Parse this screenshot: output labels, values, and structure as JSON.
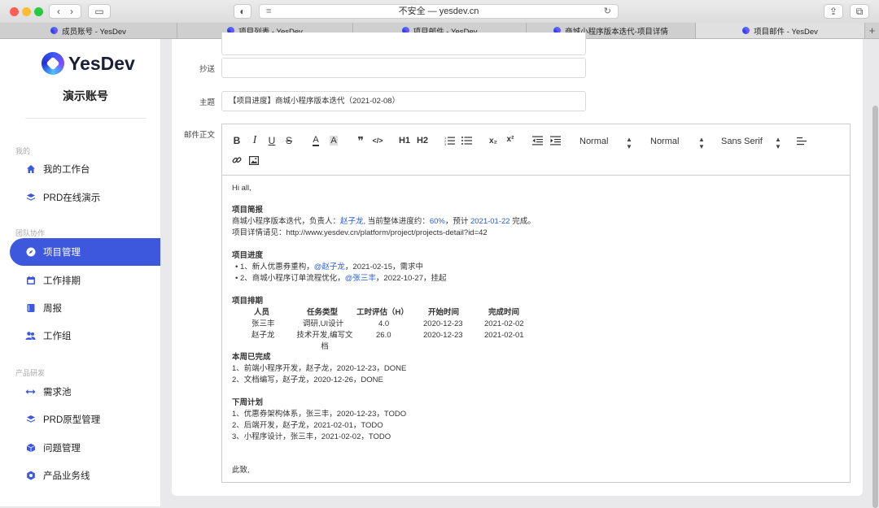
{
  "browser": {
    "address": "不安全 — yesdev.cn",
    "tabs": [
      {
        "label": "成员账号 - YesDev",
        "active": false
      },
      {
        "label": "项目列表 - YesDev",
        "active": false
      },
      {
        "label": "项目邮件 - YesDev",
        "active": false
      },
      {
        "label": "商城小程序版本迭代-项目详情",
        "active": false
      },
      {
        "label": "项目邮件 - YesDev",
        "active": true
      }
    ],
    "new_tab": "+"
  },
  "sidebar": {
    "logo_text": "YesDev",
    "account": "演示账号",
    "groups": [
      "我的",
      "团队协作",
      "产品研发"
    ],
    "items": [
      {
        "label": "我的工作台",
        "icon": "home-icon"
      },
      {
        "label": "PRD在线演示",
        "icon": "layers-icon"
      },
      {
        "label": "项目管理",
        "icon": "compass-icon",
        "active": true
      },
      {
        "label": "工作排期",
        "icon": "calendar-icon"
      },
      {
        "label": "周报",
        "icon": "book-icon"
      },
      {
        "label": "工作组",
        "icon": "group-icon"
      },
      {
        "label": "需求池",
        "icon": "arrows-icon"
      },
      {
        "label": "PRD原型管理",
        "icon": "layers-icon"
      },
      {
        "label": "问题管理",
        "icon": "cube-icon"
      },
      {
        "label": "产品业务线",
        "icon": "gear-icon"
      }
    ]
  },
  "form": {
    "cc_label": "抄送",
    "cc_value": "",
    "subject_label": "主题",
    "subject_value": "【项目进度】商城小程序版本迭代（2021-02-08）",
    "body_label": "邮件正文"
  },
  "toolbar": {
    "bold": "B",
    "italic": "I",
    "underline": "U",
    "strike": "S",
    "quote": "❞",
    "code": "</>",
    "h1": "H1",
    "h2": "H2",
    "sub": "x₂",
    "sup": "x²",
    "select1": "Normal",
    "select2": "Normal",
    "select3": "Sans Serif"
  },
  "email": {
    "greeting": "Hi all,",
    "brief_title": "项目简报",
    "brief_l1_a": "商城小程序版本迭代，负责人：",
    "brief_owner": "赵子龙",
    "brief_l1_b": ", 当前整体进度约：",
    "brief_progress": "60%",
    "brief_l1_c": "，预计 ",
    "brief_date": "2021-01-22",
    "brief_l1_d": " 完成。",
    "brief_l2": "项目详情请见：http://www.yesdev.cn/platform/project/projects-detail?id=42",
    "progress_title": "项目进度",
    "progress_1a": "• 1、新人优惠券重构，",
    "progress_1_user": "@赵子龙",
    "progress_1b": "，2021-02-15，需求中",
    "progress_2a": "• 2、商城小程序订单流程优化，",
    "progress_2_user": "@张三丰",
    "progress_2b": "，2022-10-27，挂起",
    "schedule_title": "项目排期",
    "schedule_headers": [
      "人员",
      "任务类型",
      "工时评估（H）",
      "开始时间",
      "完成时间"
    ],
    "schedule_rows": [
      [
        "张三丰",
        "调研,UI设计",
        "4.0",
        "2020-12-23",
        "2021-02-02"
      ],
      [
        "赵子龙",
        "技术开发,编写文档",
        "26.0",
        "2020-12-23",
        "2021-02-01"
      ]
    ],
    "done_title": "本周已完成",
    "done": [
      "1、前端小程序开发，赵子龙，2020-12-23，DONE",
      "2、文档编写，赵子龙，2020-12-26，DONE"
    ],
    "next_title": "下周计划",
    "next": [
      "1、优惠券架构体系，张三丰，2020-12-23，TODO",
      "2、后端开发，赵子龙，2021-02-01，TODO",
      "3、小程序设计，张三丰，2021-02-02，TODO"
    ],
    "closing": "此致,"
  }
}
